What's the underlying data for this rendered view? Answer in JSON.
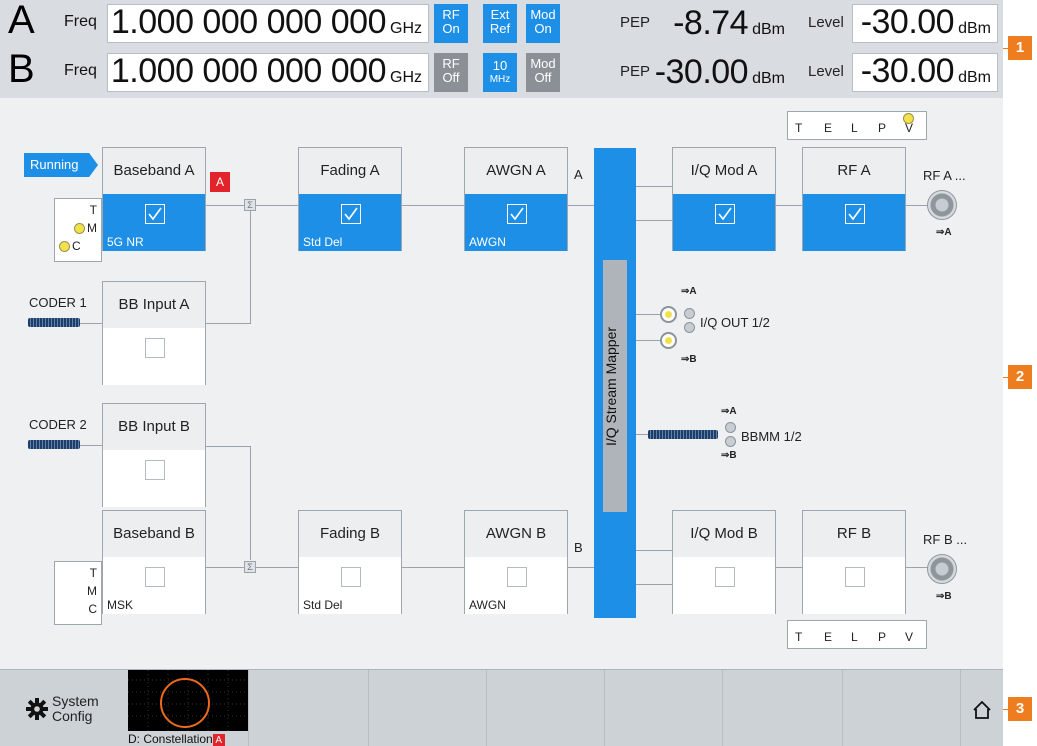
{
  "header": {
    "rows": [
      {
        "path": "A",
        "freq_label": "Freq",
        "freq_value": "1.000 000 000 000",
        "freq_unit": "GHz",
        "rf": "RF On",
        "rf_l1": "RF",
        "rf_l2": "On",
        "ref_l1": "Ext",
        "ref_l2": "Ref",
        "mod_l1": "Mod",
        "mod_l2": "On",
        "pep_label": "PEP",
        "pep_value": "-8.74",
        "pep_unit": "dBm",
        "level_label": "Level",
        "level_value": "-30.00",
        "level_unit": "dBm"
      },
      {
        "path": "B",
        "freq_label": "Freq",
        "freq_value": "1.000 000 000 000",
        "freq_unit": "GHz",
        "rf_l1": "RF",
        "rf_l2": "Off",
        "ref_l1": "10",
        "ref_l2": "MHz",
        "mod_l1": "Mod",
        "mod_l2": "Off",
        "pep_label": "PEP",
        "pep_value": "-30.00",
        "pep_unit": "dBm",
        "level_label": "Level",
        "level_value": "-30.00",
        "level_unit": "dBm"
      }
    ]
  },
  "callouts": [
    "1",
    "2",
    "3"
  ],
  "diagram": {
    "running_label": "Running",
    "blocks": {
      "baseband_a": {
        "title": "Baseband A",
        "sub": "5G NR"
      },
      "fading_a": {
        "title": "Fading A",
        "sub": "Std Del"
      },
      "awgn_a": {
        "title": "AWGN A",
        "sub": "AWGN"
      },
      "iqmod_a": {
        "title": "I/Q Mod A",
        "sub": ""
      },
      "rf_a": {
        "title": "RF A",
        "sub": ""
      },
      "bbinput_a": {
        "title": "BB Input A",
        "sub": ""
      },
      "bbinput_b": {
        "title": "BB Input B",
        "sub": ""
      },
      "baseband_b": {
        "title": "Baseband B",
        "sub": "MSK"
      },
      "fading_b": {
        "title": "Fading B",
        "sub": "Std Del"
      },
      "awgn_b": {
        "title": "AWGN B",
        "sub": "AWGN"
      },
      "iqmod_b": {
        "title": "I/Q Mod B",
        "sub": ""
      },
      "rf_b": {
        "title": "RF B",
        "sub": ""
      }
    },
    "red_badge": "A",
    "tmc_a": {
      "t": "T",
      "m": "M",
      "c": "C"
    },
    "tmc_b": {
      "t": "T",
      "m": "M",
      "c": "C"
    },
    "coder1": "CODER 1",
    "coder2": "CODER 2",
    "chan_a": "A",
    "chan_b": "B",
    "mapper_label": "I/Q Stream Mapper",
    "telpv_top": [
      "T",
      "E",
      "L",
      "P",
      "V"
    ],
    "telpv_bottom": [
      "T",
      "E",
      "L",
      "P",
      "V"
    ],
    "rf_a_out": "RF A ...",
    "rf_b_out": "RF B ...",
    "arrow_a": "⇒A",
    "arrow_b": "⇒B",
    "iq_out": "I/Q OUT 1/2",
    "bbmm": "BBMM 1/2"
  },
  "taskbar": {
    "system_l1": "System",
    "system_l2": "Config",
    "thumb_caption": "D: Constellation",
    "thumb_badge": "A"
  },
  "colors": {
    "accent": "#1e8fe6",
    "callout": "#ee7d1f",
    "alert": "#e3232b"
  }
}
